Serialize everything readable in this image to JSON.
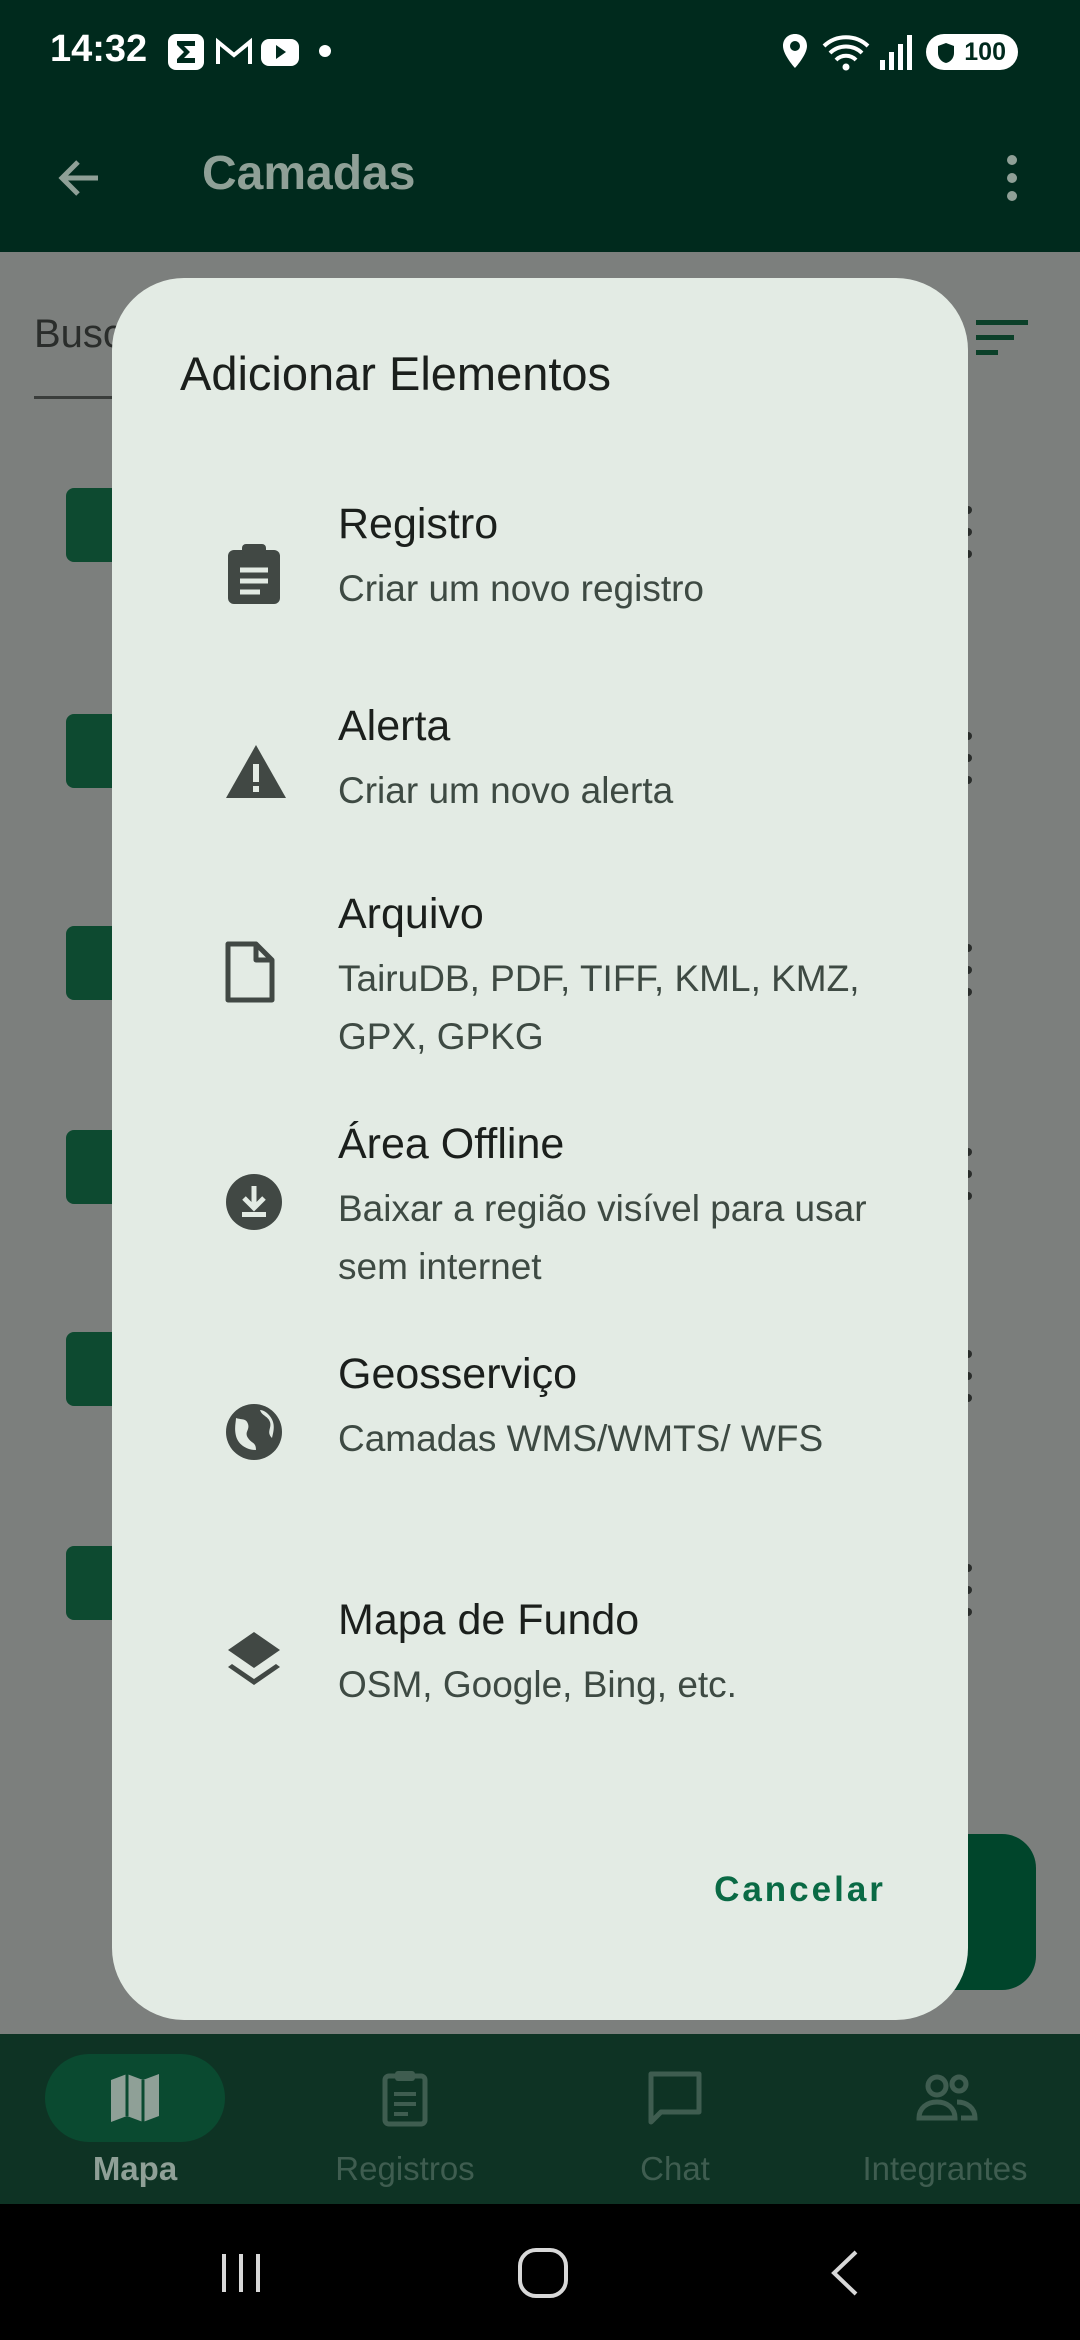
{
  "status_bar": {
    "time": "14:32",
    "battery": "100"
  },
  "app_bar": {
    "title": "Camadas"
  },
  "search": {
    "placeholder": "Busc"
  },
  "dialog": {
    "title": "Adicionar Elementos",
    "options": [
      {
        "title": "Registro",
        "subtitle": "Criar um novo registro",
        "icon": "clipboard-icon"
      },
      {
        "title": "Alerta",
        "subtitle": "Criar um novo alerta",
        "icon": "warning-icon"
      },
      {
        "title": "Arquivo",
        "subtitle": "TairuDB, PDF, TIFF, KML, KMZ, GPX, GPKG",
        "icon": "file-icon"
      },
      {
        "title": "Área Offline",
        "subtitle": "Baixar a região visível para usar sem internet",
        "icon": "download-icon"
      },
      {
        "title": "Geosserviço",
        "subtitle": "Camadas WMS/WMTS/ WFS",
        "icon": "globe-icon"
      },
      {
        "title": "Mapa de Fundo",
        "subtitle": "OSM, Google, Bing, etc.",
        "icon": "layers-icon"
      }
    ],
    "cancel_label": "Cancelar"
  },
  "bottom_nav": {
    "items": [
      {
        "label": "Mapa",
        "icon": "map-icon",
        "active": true
      },
      {
        "label": "Registros",
        "icon": "clipboard-icon",
        "active": false
      },
      {
        "label": "Chat",
        "icon": "chat-icon",
        "active": false
      },
      {
        "label": "Integrantes",
        "icon": "people-icon",
        "active": false
      }
    ]
  },
  "colors": {
    "app_bar": "#002a1d",
    "dialog_bg": "#e3ebe4",
    "accent": "#0a6a45",
    "scrim": "#7c7f7d"
  }
}
